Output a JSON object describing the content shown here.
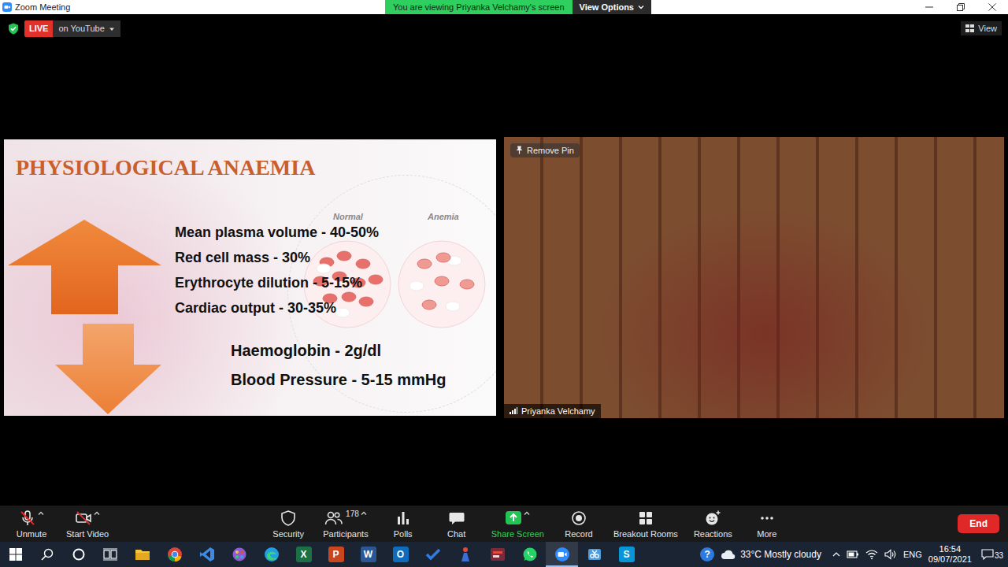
{
  "window": {
    "title": "Zoom Meeting"
  },
  "banner": {
    "text": "You are viewing Priyanka Velchamy's screen",
    "options": "View Options"
  },
  "stream": {
    "badge": "LIVE",
    "target": "on YouTube"
  },
  "view_menu": {
    "label": "View"
  },
  "slide": {
    "title": "PHYSIOLOGICAL ANAEMIA",
    "cells": [
      {
        "label": "Normal",
        "kind": "normal"
      },
      {
        "label": "Anemia",
        "kind": "anemia"
      }
    ],
    "increases": [
      "Mean plasma volume - 40-50%",
      "Red cell mass - 30%",
      "Erythrocyte dilution - 5-15%",
      "Cardiac output - 30-35%"
    ],
    "decreases": [
      "Haemoglobin - 2g/dl",
      "Blood Pressure - 5-15 mmHg"
    ]
  },
  "video": {
    "name": "Priyanka Velchamy",
    "pin": "Remove Pin"
  },
  "toolbar": {
    "left": [
      {
        "label": "Unmute",
        "kind": "mic",
        "muted": true,
        "menu": true
      },
      {
        "label": "Start Video",
        "kind": "camera",
        "muted": true,
        "menu": true
      }
    ],
    "center": [
      {
        "label": "Security",
        "kind": "shield",
        "menu": false
      },
      {
        "label": "Participants",
        "kind": "people",
        "menu": true,
        "count": "178"
      },
      {
        "label": "Polls",
        "kind": "polls",
        "menu": false
      },
      {
        "label": "Chat",
        "kind": "chat",
        "menu": false
      },
      {
        "label": "Share Screen",
        "kind": "share",
        "menu": true
      },
      {
        "label": "Record",
        "kind": "record",
        "menu": false
      },
      {
        "label": "Breakout Rooms",
        "kind": "rooms",
        "menu": false
      },
      {
        "label": "Reactions",
        "kind": "reactions",
        "menu": false
      },
      {
        "label": "More",
        "kind": "more",
        "menu": false
      }
    ],
    "end": "End"
  },
  "taskbar": {
    "apps": [
      {
        "kind": "folder",
        "color": "#f4c542",
        "selected": false
      },
      {
        "kind": "chrome",
        "color": "#db4437",
        "selected": false
      },
      {
        "kind": "bolt",
        "color": "#3c8ce7",
        "selected": false
      },
      {
        "kind": "paint",
        "color": "#8e5bd6",
        "selected": false
      },
      {
        "kind": "edge",
        "color": "#1fa0e0",
        "selected": false
      },
      {
        "kind": "letter",
        "glyph": "X",
        "color": "#1d7044",
        "selected": false
      },
      {
        "kind": "letter",
        "glyph": "P",
        "color": "#c8471f",
        "selected": false
      },
      {
        "kind": "letter",
        "glyph": "W",
        "color": "#2b5797",
        "selected": false
      },
      {
        "kind": "letter",
        "glyph": "O",
        "color": "#0f6cbd",
        "selected": false
      },
      {
        "kind": "check",
        "color": "#2f7de1",
        "selected": false
      },
      {
        "kind": "figure",
        "color": "#e24a3b",
        "selected": false
      },
      {
        "kind": "tile",
        "color": "#7b2a3a",
        "selected": false
      },
      {
        "kind": "whatsapp",
        "color": "#25d366",
        "selected": false
      },
      {
        "kind": "zoom",
        "color": "#2d8cff",
        "selected": true
      },
      {
        "kind": "snip",
        "color": "#4a9be0",
        "selected": false
      },
      {
        "kind": "letter",
        "glyph": "S",
        "color": "#0a94d8",
        "selected": false
      }
    ],
    "help": "?",
    "weather": "33°C Mostly cloudy",
    "language": "ENG",
    "time": "16:54",
    "date": "09/07/2021",
    "notifications": "33"
  }
}
